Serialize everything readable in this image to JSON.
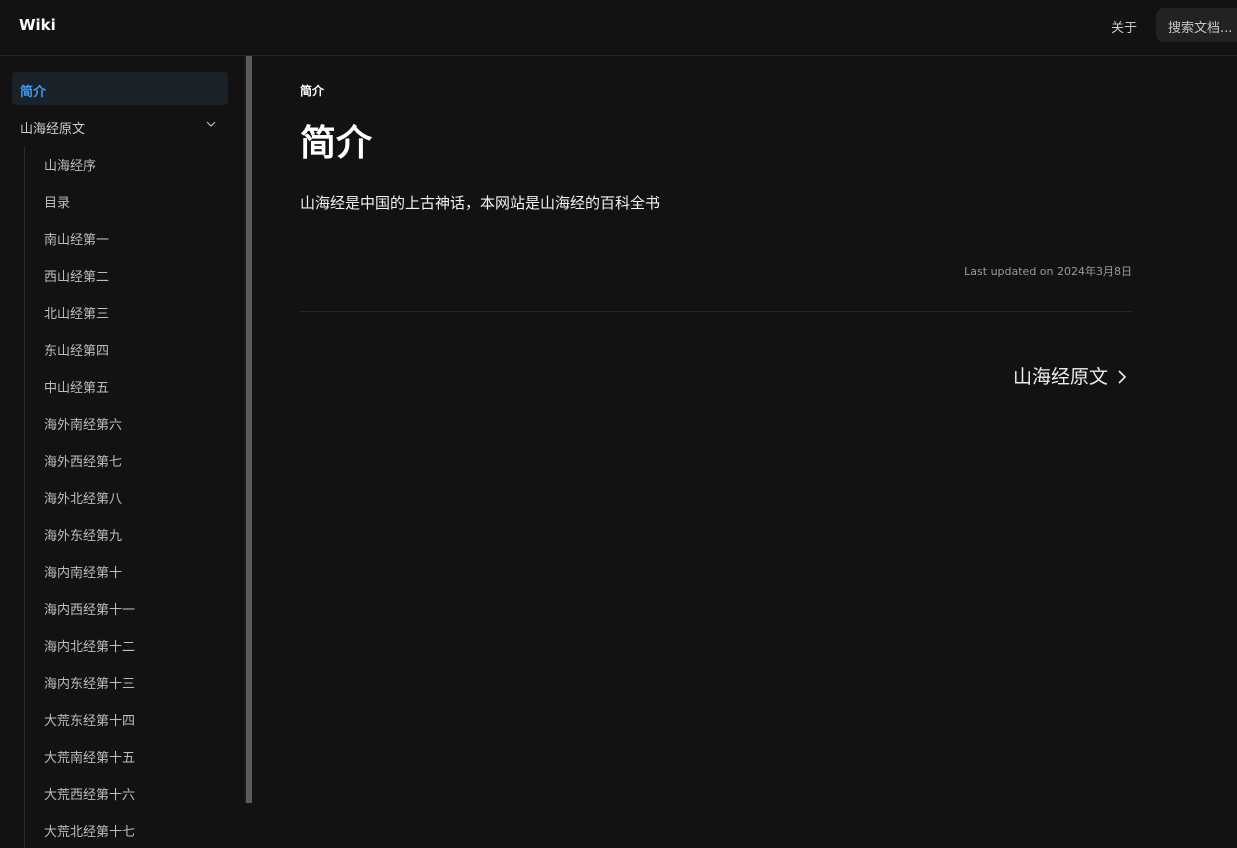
{
  "header": {
    "site_title": "Wiki",
    "about_label": "关于",
    "search_placeholder": "搜索文档..."
  },
  "sidebar": {
    "active_item": "简介",
    "group_label": "山海经原文",
    "group_expanded": true,
    "sub_items": [
      "山海经序",
      "目录",
      "南山经第一",
      "西山经第二",
      "北山经第三",
      "东山经第四",
      "中山经第五",
      "海外南经第六",
      "海外西经第七",
      "海外北经第八",
      "海外东经第九",
      "海内南经第十",
      "海内西经第十一",
      "海内北经第十二",
      "海内东经第十三",
      "大荒东经第十四",
      "大荒南经第十五",
      "大荒西经第十六",
      "大荒北经第十七"
    ]
  },
  "main": {
    "breadcrumb": "简介",
    "title": "简介",
    "intro": "山海经是中国的上古神话，本网站是山海经的百科全书",
    "last_updated": "Last updated on 2024年3月8日",
    "next_link_label": "山海经原文"
  },
  "colors": {
    "background": "#121212",
    "accent": "#3e9bf2",
    "active_bg": "#1b2129"
  }
}
